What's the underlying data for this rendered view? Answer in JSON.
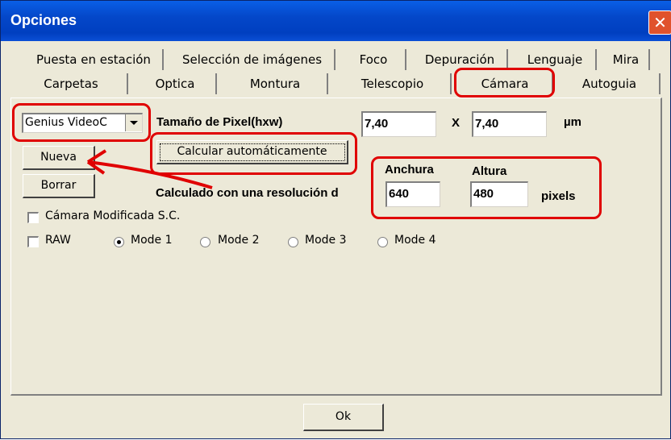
{
  "window": {
    "title": "Opciones",
    "close_glyph": "✕"
  },
  "tabs_row1": [
    "Puesta en estación",
    "Selección de imágenes",
    "Foco",
    "Depuración",
    "Lenguaje",
    "Mira"
  ],
  "tabs_row2": [
    "Carpetas",
    "Optica",
    "Montura",
    "Telescopio",
    "Cámara",
    "Autoguia"
  ],
  "active_tab": "Cámara",
  "camera": {
    "select_value": "Genius VideoC",
    "new_button": "Nueva",
    "delete_button": "Borrar",
    "pixel_size_label": "Tamaño de Pixel(hxw)",
    "pixel_h": "7,40",
    "x_label": "X",
    "pixel_w": "7,40",
    "unit_um": "µm",
    "auto_calc_button": "Calcular automáticamente",
    "calc_label": "Calculado con una resolución d",
    "width_label": "Anchura",
    "height_label": "Altura",
    "width_value": "640",
    "height_value": "480",
    "pixels_label": "pixels",
    "modified_checkbox": "Cámara Modificada S.C.",
    "raw_checkbox": "RAW",
    "modes": [
      "Mode 1",
      "Mode 2",
      "Mode 3",
      "Mode 4"
    ],
    "selected_mode": "Mode 1"
  },
  "footer": {
    "ok_button": "Ok"
  },
  "colors": {
    "titlebar": "#0447c9",
    "face": "#ece9d8",
    "annotation": "#e00000"
  }
}
